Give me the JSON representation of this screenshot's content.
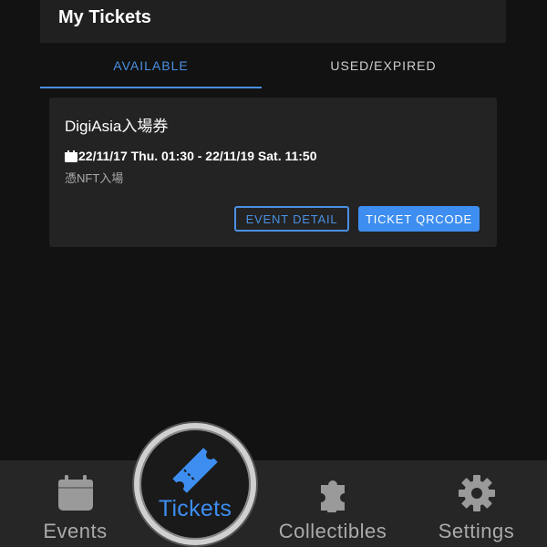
{
  "header": {
    "title": "My Tickets"
  },
  "tabs": [
    {
      "label": "AVAILABLE",
      "active": true
    },
    {
      "label": "USED/EXPIRED",
      "active": false
    }
  ],
  "ticket": {
    "title": "DigiAsia入場券",
    "date_range": "22/11/17 Thu. 01:30 - 22/11/19 Sat. 11:50",
    "description": "憑NFT入場",
    "event_detail_label": "EVENT DETAIL",
    "qrcode_label": "TICKET QRCODE"
  },
  "bottom_nav": {
    "events": {
      "label": "Events",
      "icon": "calendar-icon"
    },
    "tickets": {
      "label": "Tickets",
      "icon": "ticket-icon",
      "active": true
    },
    "collectibles": {
      "label": "Collectibles",
      "icon": "puzzle-icon"
    },
    "settings": {
      "label": "Settings",
      "icon": "gear-icon"
    }
  },
  "colors": {
    "accent": "#4a90e2",
    "primary_button": "#3d8ef0",
    "background": "#121212",
    "card": "#232323",
    "nav_bg": "#262626"
  }
}
